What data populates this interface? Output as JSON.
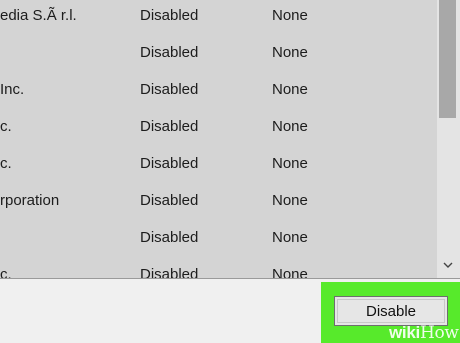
{
  "rows": [
    {
      "publisher": "edia S.Ã  r.l.",
      "status": "Disabled",
      "impact": "None"
    },
    {
      "publisher": "",
      "status": "Disabled",
      "impact": "None"
    },
    {
      "publisher": "Inc.",
      "status": "Disabled",
      "impact": "None"
    },
    {
      "publisher": "c.",
      "status": "Disabled",
      "impact": "None"
    },
    {
      "publisher": "c.",
      "status": "Disabled",
      "impact": "None"
    },
    {
      "publisher": "rporation",
      "status": "Disabled",
      "impact": "None"
    },
    {
      "publisher": "",
      "status": "Disabled",
      "impact": "None"
    },
    {
      "publisher": "c.",
      "status": "Disabled",
      "impact": "None"
    }
  ],
  "footer": {
    "disable_label": "Disable"
  },
  "watermark": {
    "part1": "wiki",
    "part2": "How"
  },
  "colors": {
    "list_background": "#d4d4d4",
    "highlight": "#57ea2b",
    "scroll_thumb": "#a8a8a8"
  },
  "icons": {
    "scroll_down": "chevron-down-icon"
  }
}
